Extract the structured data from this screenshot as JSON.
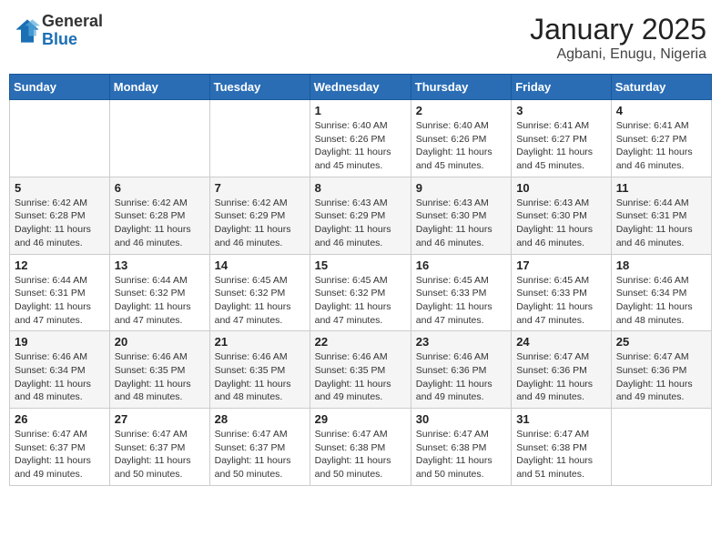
{
  "logo": {
    "general": "General",
    "blue": "Blue"
  },
  "title": "January 2025",
  "subtitle": "Agbani, Enugu, Nigeria",
  "weekdays": [
    "Sunday",
    "Monday",
    "Tuesday",
    "Wednesday",
    "Thursday",
    "Friday",
    "Saturday"
  ],
  "weeks": [
    [
      {
        "day": "",
        "info": ""
      },
      {
        "day": "",
        "info": ""
      },
      {
        "day": "",
        "info": ""
      },
      {
        "day": "1",
        "info": "Sunrise: 6:40 AM\nSunset: 6:26 PM\nDaylight: 11 hours and 45 minutes."
      },
      {
        "day": "2",
        "info": "Sunrise: 6:40 AM\nSunset: 6:26 PM\nDaylight: 11 hours and 45 minutes."
      },
      {
        "day": "3",
        "info": "Sunrise: 6:41 AM\nSunset: 6:27 PM\nDaylight: 11 hours and 45 minutes."
      },
      {
        "day": "4",
        "info": "Sunrise: 6:41 AM\nSunset: 6:27 PM\nDaylight: 11 hours and 46 minutes."
      }
    ],
    [
      {
        "day": "5",
        "info": "Sunrise: 6:42 AM\nSunset: 6:28 PM\nDaylight: 11 hours and 46 minutes."
      },
      {
        "day": "6",
        "info": "Sunrise: 6:42 AM\nSunset: 6:28 PM\nDaylight: 11 hours and 46 minutes."
      },
      {
        "day": "7",
        "info": "Sunrise: 6:42 AM\nSunset: 6:29 PM\nDaylight: 11 hours and 46 minutes."
      },
      {
        "day": "8",
        "info": "Sunrise: 6:43 AM\nSunset: 6:29 PM\nDaylight: 11 hours and 46 minutes."
      },
      {
        "day": "9",
        "info": "Sunrise: 6:43 AM\nSunset: 6:30 PM\nDaylight: 11 hours and 46 minutes."
      },
      {
        "day": "10",
        "info": "Sunrise: 6:43 AM\nSunset: 6:30 PM\nDaylight: 11 hours and 46 minutes."
      },
      {
        "day": "11",
        "info": "Sunrise: 6:44 AM\nSunset: 6:31 PM\nDaylight: 11 hours and 46 minutes."
      }
    ],
    [
      {
        "day": "12",
        "info": "Sunrise: 6:44 AM\nSunset: 6:31 PM\nDaylight: 11 hours and 47 minutes."
      },
      {
        "day": "13",
        "info": "Sunrise: 6:44 AM\nSunset: 6:32 PM\nDaylight: 11 hours and 47 minutes."
      },
      {
        "day": "14",
        "info": "Sunrise: 6:45 AM\nSunset: 6:32 PM\nDaylight: 11 hours and 47 minutes."
      },
      {
        "day": "15",
        "info": "Sunrise: 6:45 AM\nSunset: 6:32 PM\nDaylight: 11 hours and 47 minutes."
      },
      {
        "day": "16",
        "info": "Sunrise: 6:45 AM\nSunset: 6:33 PM\nDaylight: 11 hours and 47 minutes."
      },
      {
        "day": "17",
        "info": "Sunrise: 6:45 AM\nSunset: 6:33 PM\nDaylight: 11 hours and 47 minutes."
      },
      {
        "day": "18",
        "info": "Sunrise: 6:46 AM\nSunset: 6:34 PM\nDaylight: 11 hours and 48 minutes."
      }
    ],
    [
      {
        "day": "19",
        "info": "Sunrise: 6:46 AM\nSunset: 6:34 PM\nDaylight: 11 hours and 48 minutes."
      },
      {
        "day": "20",
        "info": "Sunrise: 6:46 AM\nSunset: 6:35 PM\nDaylight: 11 hours and 48 minutes."
      },
      {
        "day": "21",
        "info": "Sunrise: 6:46 AM\nSunset: 6:35 PM\nDaylight: 11 hours and 48 minutes."
      },
      {
        "day": "22",
        "info": "Sunrise: 6:46 AM\nSunset: 6:35 PM\nDaylight: 11 hours and 49 minutes."
      },
      {
        "day": "23",
        "info": "Sunrise: 6:46 AM\nSunset: 6:36 PM\nDaylight: 11 hours and 49 minutes."
      },
      {
        "day": "24",
        "info": "Sunrise: 6:47 AM\nSunset: 6:36 PM\nDaylight: 11 hours and 49 minutes."
      },
      {
        "day": "25",
        "info": "Sunrise: 6:47 AM\nSunset: 6:36 PM\nDaylight: 11 hours and 49 minutes."
      }
    ],
    [
      {
        "day": "26",
        "info": "Sunrise: 6:47 AM\nSunset: 6:37 PM\nDaylight: 11 hours and 49 minutes."
      },
      {
        "day": "27",
        "info": "Sunrise: 6:47 AM\nSunset: 6:37 PM\nDaylight: 11 hours and 50 minutes."
      },
      {
        "day": "28",
        "info": "Sunrise: 6:47 AM\nSunset: 6:37 PM\nDaylight: 11 hours and 50 minutes."
      },
      {
        "day": "29",
        "info": "Sunrise: 6:47 AM\nSunset: 6:38 PM\nDaylight: 11 hours and 50 minutes."
      },
      {
        "day": "30",
        "info": "Sunrise: 6:47 AM\nSunset: 6:38 PM\nDaylight: 11 hours and 50 minutes."
      },
      {
        "day": "31",
        "info": "Sunrise: 6:47 AM\nSunset: 6:38 PM\nDaylight: 11 hours and 51 minutes."
      },
      {
        "day": "",
        "info": ""
      }
    ]
  ]
}
